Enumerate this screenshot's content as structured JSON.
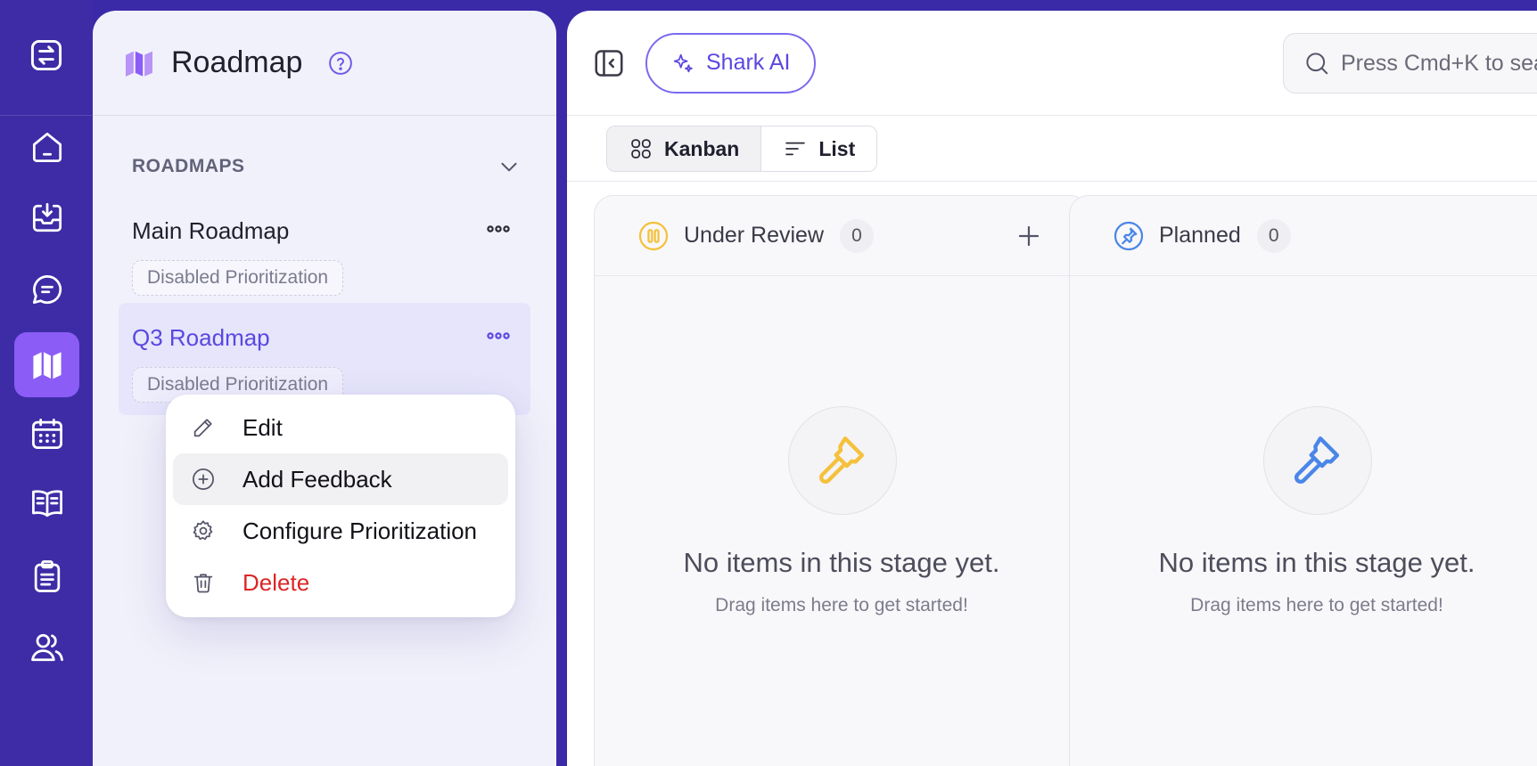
{
  "rail": {
    "items": [
      {
        "name": "home"
      },
      {
        "name": "inbox"
      },
      {
        "name": "feedback"
      },
      {
        "name": "roadmap",
        "active": true
      },
      {
        "name": "calendar"
      },
      {
        "name": "docs"
      },
      {
        "name": "changelog"
      },
      {
        "name": "users"
      }
    ]
  },
  "panel": {
    "title": "Roadmap",
    "section_label": "ROADMAPS",
    "roadmaps": [
      {
        "name": "Main Roadmap",
        "badge": "Disabled Prioritization"
      },
      {
        "name": "Q3 Roadmap",
        "badge": "Disabled Prioritization"
      }
    ]
  },
  "context_menu": {
    "items": [
      {
        "label": "Edit",
        "icon": "pencil-icon"
      },
      {
        "label": "Add Feedback",
        "icon": "plus-circle-icon"
      },
      {
        "label": "Configure Prioritization",
        "icon": "gear-icon"
      },
      {
        "label": "Delete",
        "icon": "trash-icon"
      }
    ]
  },
  "topbar": {
    "ai_button_label": "Shark AI",
    "search_placeholder": "Press Cmd+K to search"
  },
  "views": {
    "kanban_label": "Kanban",
    "list_label": "List",
    "active": "Kanban"
  },
  "columns": [
    {
      "title": "Under Review",
      "count": "0",
      "color": "#f5c13c",
      "empty_title": "No items in this stage yet.",
      "empty_subtitle": "Drag items here to get started!"
    },
    {
      "title": "Planned",
      "count": "0",
      "color": "#4a86e8",
      "empty_title": "No items in this stage yet.",
      "empty_subtitle": "Drag items here to get started!"
    }
  ],
  "colors": {
    "rail_bg": "#3d2ca6",
    "accent": "#5b47e0",
    "active_rail": "#8b5cf6",
    "danger": "#dc2626"
  }
}
